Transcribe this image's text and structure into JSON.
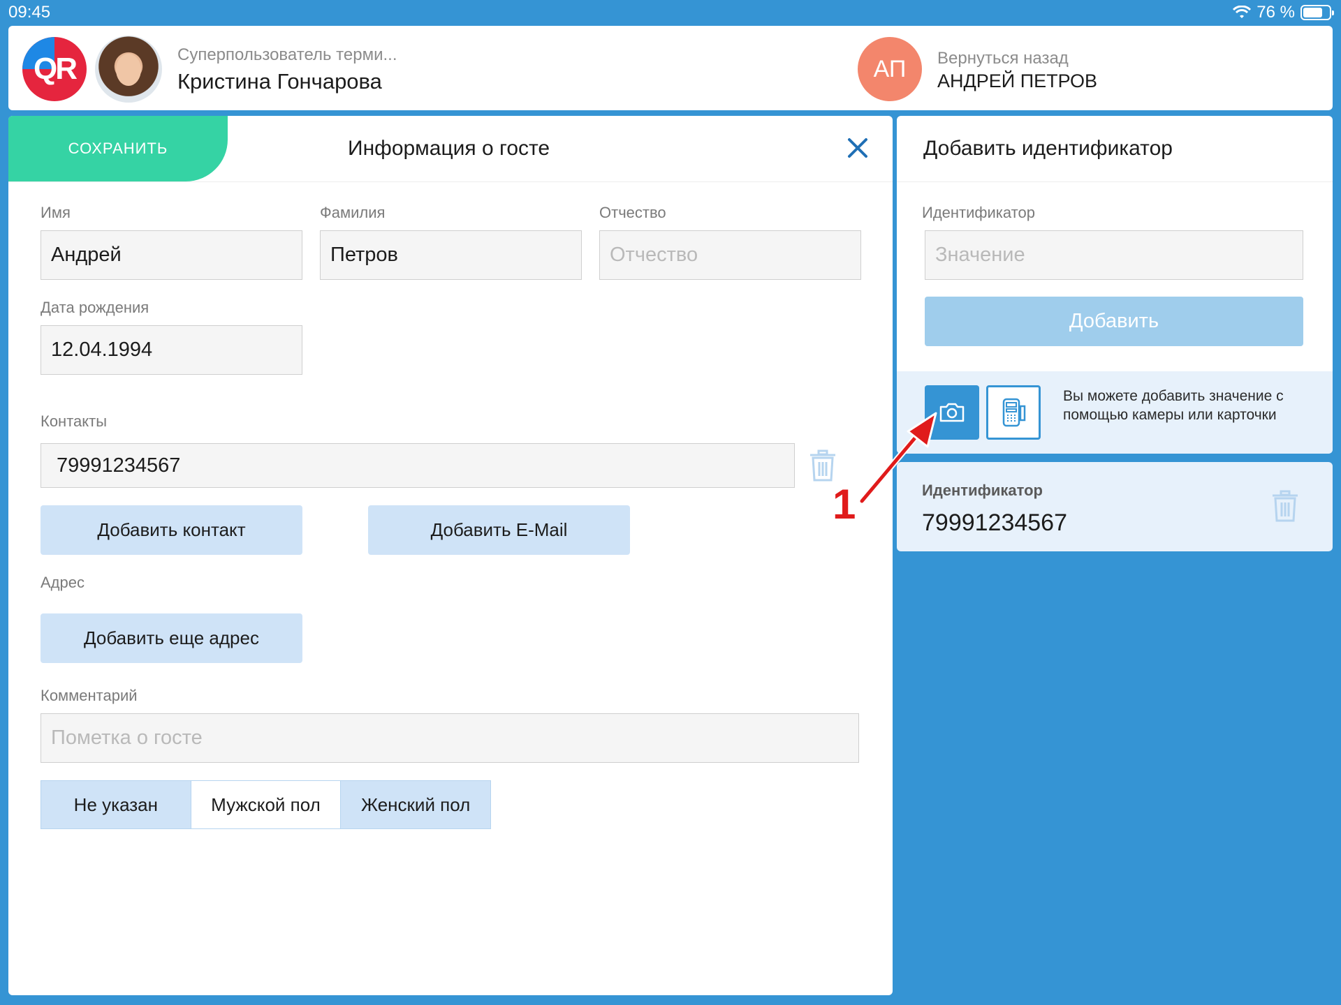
{
  "status_bar": {
    "time": "09:45",
    "battery": "76 %",
    "battery_level": 0.76
  },
  "header": {
    "logo_text": "QR",
    "user_role": "Суперпользователь терми...",
    "user_name": "Кристина Гончарова",
    "guest_initials": "АП",
    "back_label": "Вернуться назад",
    "guest_name": "АНДРЕЙ ПЕТРОВ"
  },
  "guest_info": {
    "save_label": "СОХРАНИТЬ",
    "title": "Информация о госте",
    "first_name": {
      "label": "Имя",
      "value": "Андрей"
    },
    "last_name": {
      "label": "Фамилия",
      "value": "Петров"
    },
    "patronymic": {
      "label": "Отчество",
      "placeholder": "Отчество"
    },
    "birth_date": {
      "label": "Дата рождения",
      "value": "12.04.1994"
    },
    "contacts": {
      "label": "Контакты",
      "value": "79991234567"
    },
    "add_contact_label": "Добавить контакт",
    "add_email_label": "Добавить E-Mail",
    "address": {
      "label": "Адрес",
      "add_label": "Добавить еще адрес"
    },
    "comment": {
      "label": "Комментарий",
      "placeholder": "Пометка о госте"
    },
    "gender_options": [
      "Не указан",
      "Мужской пол",
      "Женский пол"
    ],
    "gender_selected": "Мужской пол"
  },
  "identifier_panel": {
    "title": "Добавить идентификатор",
    "field_label": "Идентификатор",
    "placeholder": "Значение",
    "add_label": "Добавить",
    "hint": "Вы можете добавить значение с помощью камеры или карточки"
  },
  "identifier_card": {
    "label": "Идентификатор",
    "value": "79991234567"
  },
  "annotation": {
    "number": "1"
  },
  "colors": {
    "background": "#3594d4",
    "save": "#35d3a4",
    "light_button": "#cfe3f7",
    "annotation": "#e01b1b",
    "guest_avatar": "#f3866c"
  }
}
